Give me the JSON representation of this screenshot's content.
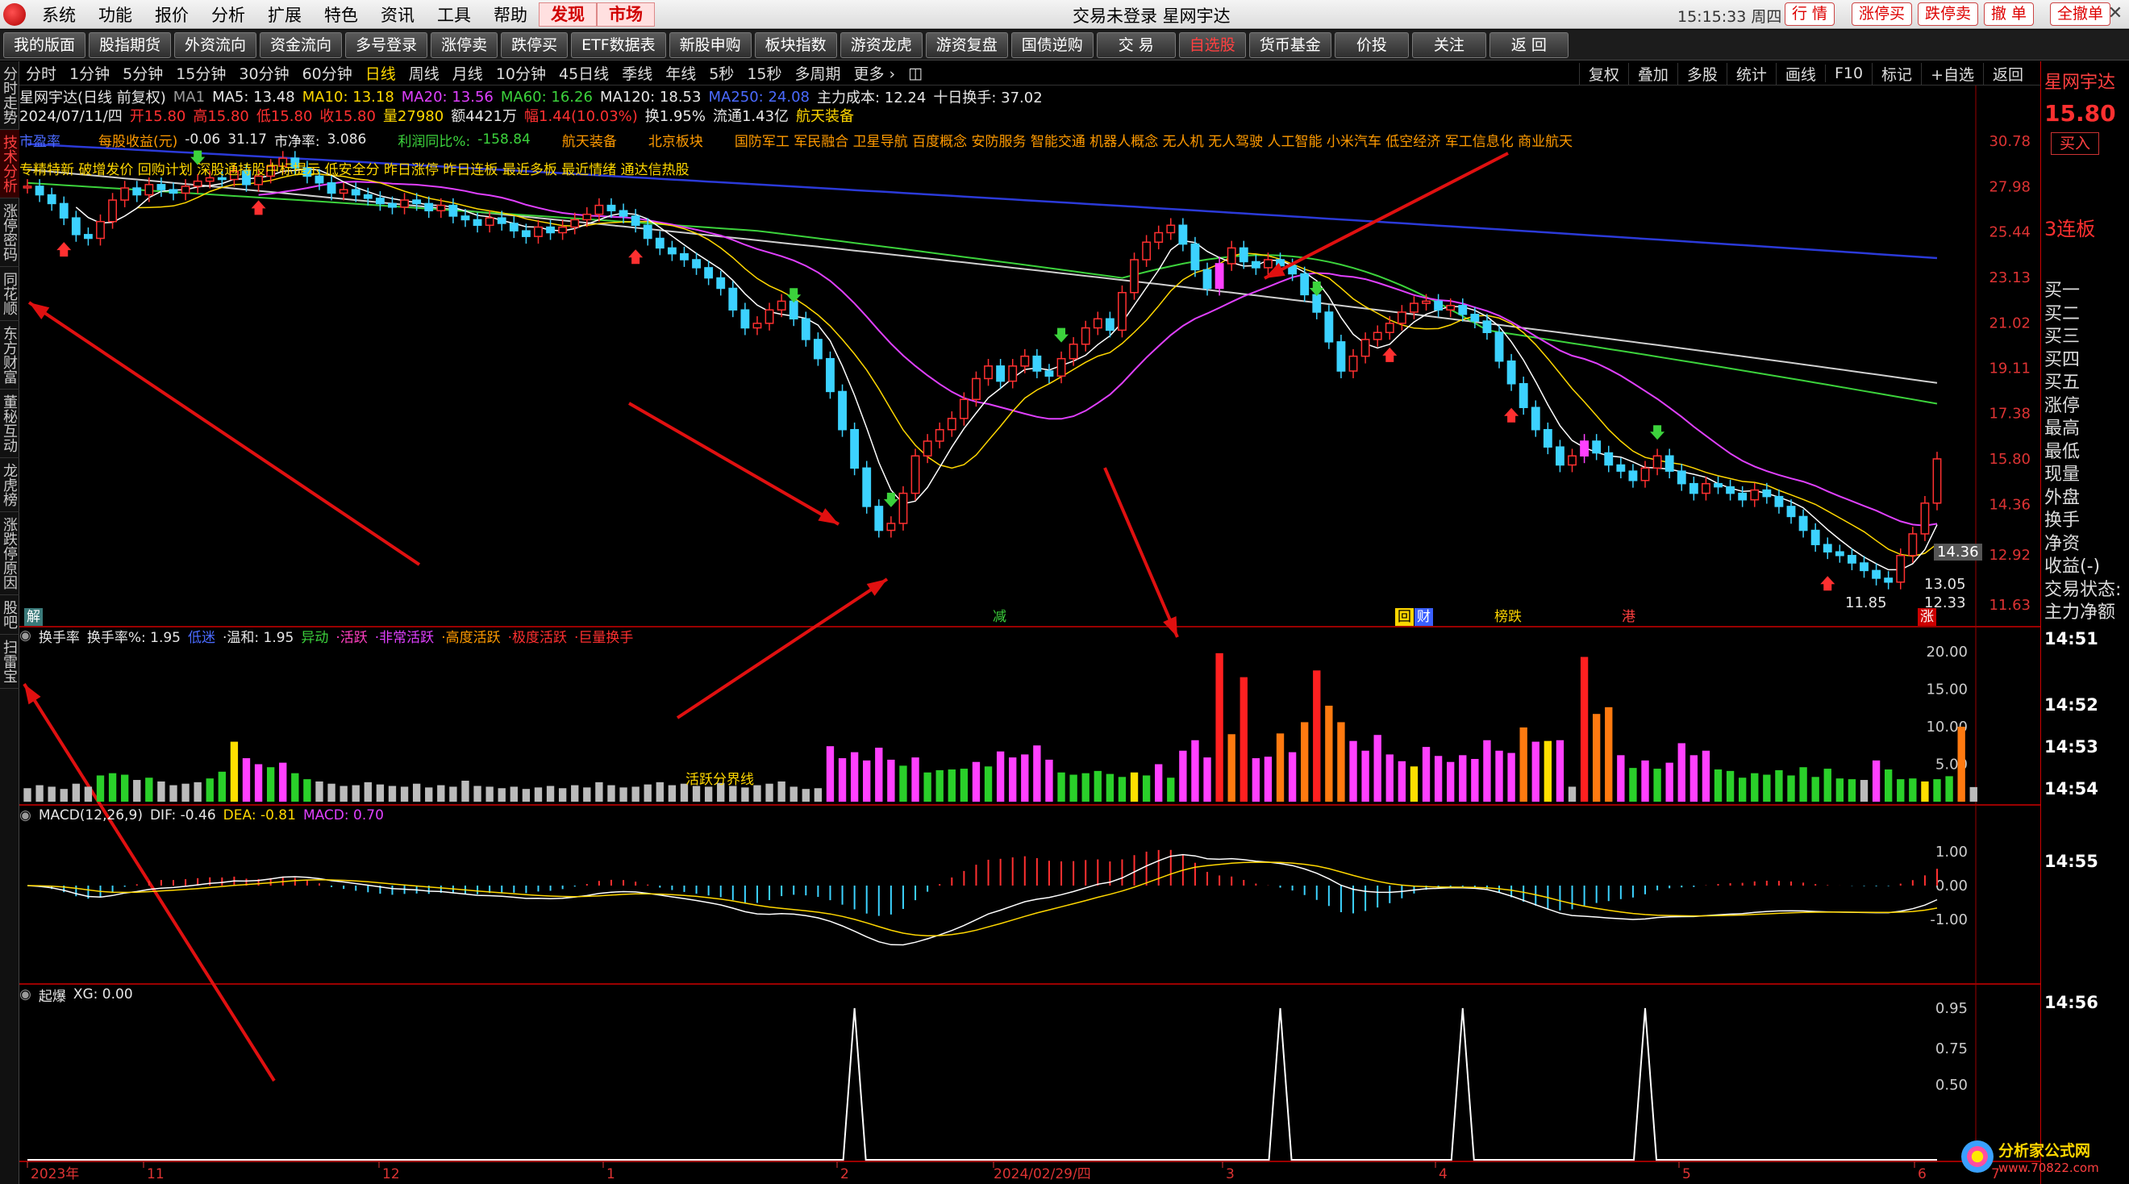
{
  "menubar": {
    "items": [
      "系统",
      "功能",
      "报价",
      "分析",
      "扩展",
      "特色",
      "资讯",
      "工具",
      "帮助"
    ],
    "highlight_items": [
      "发现",
      "市场"
    ],
    "center_title": "交易未登录  星网宇达",
    "clock": "15:15:33 周四",
    "right_buttons": [
      "行 情",
      "涨停买",
      "跌停卖",
      "撤 单",
      "全撤单"
    ]
  },
  "toolbar": {
    "buttons": [
      "我的版面",
      "股指期货",
      "外资流向",
      "资金流向",
      "多号登录",
      "涨停卖",
      "跌停买",
      "ETF数据表",
      "新股申购",
      "板块指数",
      "游资龙虎",
      "游资复盘",
      "国债逆购",
      "交 易",
      "自选股",
      "货币基金",
      "价投",
      "关注",
      "返 回"
    ],
    "active": "自选股"
  },
  "periodbar": {
    "items": [
      "分时",
      "1分钟",
      "5分钟",
      "15分钟",
      "30分钟",
      "60分钟",
      "日线",
      "周线",
      "月线",
      "10分钟",
      "45日线",
      "季线",
      "年线",
      "5秒",
      "15秒",
      "多周期",
      "更多 ›"
    ],
    "selected": "日线",
    "right_items": [
      "复权",
      "叠加",
      "多股",
      "统计",
      "画线",
      "F10",
      "标记",
      "+自选",
      "返回"
    ]
  },
  "lefttabs": [
    "分时走势",
    "技术分析",
    "涨停密码",
    "同花顺",
    "东方财富",
    "董秘互动",
    "龙虎榜",
    "涨跌停原因",
    "股吧",
    "扫雷宝"
  ],
  "lefttabs_selected": "技术分析",
  "stock_header": {
    "name": "星网宇达(日线 前复权)",
    "ma_label": "MA1",
    "ma5": "MA5: 13.48",
    "ma10": "MA10: 13.18",
    "ma20": "MA20: 13.56",
    "ma60": "MA60: 16.26",
    "ma120": "MA120: 18.53",
    "ma250": "MA250: 24.08",
    "main_cost": "主力成本: 12.24",
    "turnover10": "十日换手: 37.02",
    "date": "2024/07/11/四",
    "open": "开15.80",
    "high": "高15.80",
    "low": "低15.80",
    "close": "收15.80",
    "volume": "量27980",
    "amount": "额4421万",
    "change": "幅1.44(10.03%)",
    "turnover": "换1.95%",
    "float": "流通1.43亿",
    "sector": "航天装备"
  },
  "fund_row": {
    "label1": "市盈率",
    "label2": "每股收益(元)",
    "eps": "-0.06",
    "v1": "31.17",
    "label3": "市净率:",
    "pb": "3.086",
    "label4": "利润同比%:",
    "profit_yoy": "-158.84",
    "sector1": "航天装备",
    "sector2": "北京板块",
    "concepts": "国防军工 军民融合 卫星导航 百度概念 安防服务 智能交通 机器人概念 无人机 无人驾驶 人工智能 小米汽车 低空经济 军工信息化 商业航天"
  },
  "tags_row": "专精特新 破增发价 回购计划 深股通持股中标提示 低安全分 昨日涨停 昨日连板 最近多板 最近情绪 通达信热股",
  "price_axis": [
    "30.78",
    "27.98",
    "25.44",
    "23.13",
    "21.02",
    "19.11",
    "17.38",
    "15.80",
    "14.36",
    "12.92",
    "11.63"
  ],
  "price_marks": {
    "current": "14.36",
    "low_label": "11.85",
    "m1": "13.05",
    "m2": "12.33"
  },
  "event_tags": [
    "解",
    "减",
    "回",
    "财",
    "榜跌",
    "港",
    "涨"
  ],
  "turnover_panel": {
    "name": "换手率",
    "value_label": "换手率%: 1.95",
    "levels": [
      "低迷",
      "·温和: 1.95",
      "异动",
      "·活跃",
      "·非常活跃",
      "·高度活跃",
      "·极度活跃",
      "·巨量换手"
    ],
    "annotation": "活跃分界线",
    "axis": [
      "20.00",
      "15.00",
      "10.00",
      "5.00"
    ]
  },
  "macd_panel": {
    "name": "MACD(12,26,9)",
    "dif": "DIF: -0.46",
    "dea": "DEA: -0.81",
    "macd": "MACD: 0.70",
    "axis": [
      "1.00",
      "0.00",
      "-1.00"
    ]
  },
  "qibao_panel": {
    "name": "起爆",
    "xg": "XG: 0.00",
    "axis": [
      "0.95",
      "0.75",
      "0.50"
    ]
  },
  "time_axis": [
    "2023年",
    "11",
    "12",
    "1",
    "2",
    "2024/02/29/四",
    "3",
    "4",
    "5",
    "6",
    "7"
  ],
  "right_panel": {
    "name": "星网宇达",
    "price": "15.80",
    "buy_btn": "买入",
    "limit_tag": "3连板",
    "rows": [
      "买一",
      "买二",
      "买三",
      "买四",
      "买五",
      "涨停",
      "最高",
      "最低",
      "现量",
      "外盘",
      "换手",
      "净资",
      "收益(-)",
      "交易状态:",
      "主力净额"
    ],
    "ticks": [
      "14:51",
      "14:52",
      "14:53",
      "14:54",
      "14:55",
      "14:56"
    ]
  },
  "watermark": {
    "text": "分析家公式网",
    "url": "www.70822.com"
  },
  "colors": {
    "up": "#ff3030",
    "down": "#3cd2ff",
    "ma5": "#ffffff",
    "ma10": "#ffd700",
    "ma20": "#e040ff",
    "ma60": "#3cd23c",
    "ma120": "#cfcfcf",
    "ma250": "#2b3ad8"
  },
  "chart_data": {
    "type": "candlestick",
    "closes": [
      28.0,
      27.5,
      27.0,
      26.2,
      25.3,
      25.1,
      26.0,
      27.2,
      27.9,
      27.5,
      28.1,
      27.8,
      27.6,
      28.0,
      28.3,
      28.5,
      28.4,
      28.9,
      28.1,
      28.6,
      29.2,
      29.7,
      29.1,
      28.6,
      28.2,
      27.6,
      27.8,
      27.5,
      27.3,
      27.0,
      26.8,
      27.2,
      27.0,
      26.6,
      26.9,
      26.3,
      26.1,
      25.8,
      26.2,
      25.9,
      25.5,
      25.2,
      25.7,
      25.4,
      25.7,
      26.1,
      26.4,
      26.9,
      26.6,
      26.3,
      25.8,
      25.1,
      24.6,
      24.3,
      24.0,
      23.6,
      23.1,
      22.6,
      21.6,
      20.8,
      21.0,
      21.6,
      22.0,
      21.2,
      20.3,
      19.5,
      18.2,
      16.8,
      15.5,
      14.3,
      13.6,
      13.8,
      14.7,
      15.9,
      16.4,
      16.8,
      17.2,
      17.9,
      18.7,
      19.2,
      18.6,
      19.2,
      19.6,
      19.0,
      18.8,
      19.5,
      20.1,
      20.8,
      21.2,
      20.7,
      22.4,
      24.0,
      24.9,
      25.4,
      25.8,
      24.8,
      23.5,
      22.6,
      23.8,
      24.6,
      23.9,
      23.6,
      24.0,
      23.7,
      23.3,
      22.3,
      21.5,
      20.2,
      19.0,
      19.6,
      20.3,
      20.6,
      21.0,
      21.5,
      21.9,
      22.0,
      21.6,
      21.8,
      21.4,
      21.1,
      20.6,
      19.4,
      18.5,
      17.6,
      16.8,
      16.2,
      15.6,
      15.9,
      16.4,
      16.0,
      15.6,
      15.4,
      15.1,
      15.5,
      15.9,
      15.4,
      15.0,
      14.7,
      15.0,
      14.9,
      14.7,
      14.5,
      14.8,
      14.6,
      14.3,
      14.0,
      13.6,
      13.2,
      13.0,
      12.9,
      12.7,
      12.5,
      12.3,
      12.2,
      12.9,
      13.5,
      14.4,
      15.8
    ],
    "turnover": [
      1.8,
      2.2,
      2.0,
      1.7,
      2.4,
      2.0,
      3.5,
      3.8,
      3.6,
      2.9,
      3.2,
      2.7,
      2.2,
      2.4,
      2.6,
      3.1,
      4.0,
      8.0,
      5.8,
      5.0,
      4.6,
      5.2,
      3.8,
      3.0,
      2.7,
      2.4,
      2.1,
      2.2,
      2.6,
      2.3,
      2.1,
      2.0,
      2.4,
      1.9,
      2.2,
      2.0,
      2.8,
      2.1,
      2.0,
      1.8,
      2.0,
      1.7,
      1.9,
      2.1,
      1.8,
      2.2,
      1.9,
      2.6,
      2.2,
      1.9,
      2.0,
      2.3,
      2.6,
      2.2,
      2.4,
      2.1,
      2.0,
      2.5,
      2.1,
      1.9,
      2.2,
      2.4,
      2.7,
      2.0,
      1.7,
      1.8,
      7.4,
      5.8,
      6.6,
      5.5,
      7.2,
      5.6,
      4.8,
      5.9,
      3.9,
      4.2,
      4.3,
      4.4,
      5.3,
      4.7,
      6.7,
      5.9,
      6.3,
      7.5,
      5.6,
      3.9,
      3.6,
      3.8,
      4.1,
      3.7,
      3.3,
      3.9,
      3.5,
      5.0,
      3.2,
      6.8,
      8.2,
      5.9,
      19.8,
      9.0,
      16.6,
      5.8,
      6.0,
      9.1,
      6.6,
      10.6,
      17.5,
      12.8,
      10.6,
      8.1,
      6.8,
      8.9,
      6.3,
      5.4,
      4.7,
      7.3,
      6.1,
      5.3,
      6.2,
      5.7,
      8.2,
      6.8,
      6.5,
      9.9,
      8.0,
      8.1,
      8.2,
      2.0,
      19.3,
      11.7,
      12.6,
      6.2,
      4.5,
      5.5,
      4.4,
      5.2,
      7.8,
      6.2,
      6.8,
      4.3,
      4.1,
      3.2,
      3.8,
      3.6,
      4.2,
      3.5,
      4.6,
      3.3,
      4.4,
      3.1,
      3.0,
      2.9,
      5.5,
      4.3,
      3.0,
      3.1,
      2.7,
      3.0,
      3.4,
      10.0,
      1.95
    ]
  }
}
